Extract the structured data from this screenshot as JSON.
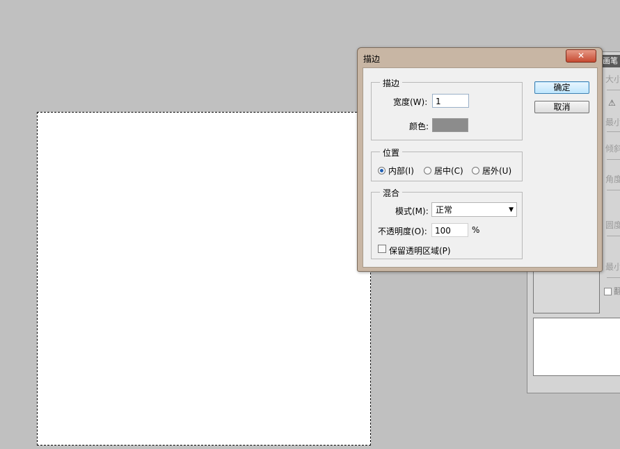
{
  "background_panel": {
    "title_fragment": "画笔",
    "labels": [
      "大小",
      "最小",
      "倾斜",
      "角度",
      "圆度",
      "最小"
    ],
    "checkbox_label": "翻"
  },
  "dialog": {
    "title": "描边",
    "close_label": "✕",
    "ok_label": "确定",
    "cancel_label": "取消",
    "stroke_group": {
      "title": "描边",
      "width_label": "宽度(W):",
      "width_value": "1",
      "color_label": "颜色:",
      "color_value": "#8c8c8c"
    },
    "location_group": {
      "title": "位置",
      "options": [
        "内部(I)",
        "居中(C)",
        "居外(U)"
      ],
      "selected": "内部(I)"
    },
    "blend_group": {
      "title": "混合",
      "mode_label": "模式(M):",
      "mode_value": "正常",
      "opacity_label": "不透明度(O):",
      "opacity_value": "100",
      "opacity_unit": "%",
      "preserve_label": "保留透明区域(P)",
      "preserve_checked": false
    }
  }
}
